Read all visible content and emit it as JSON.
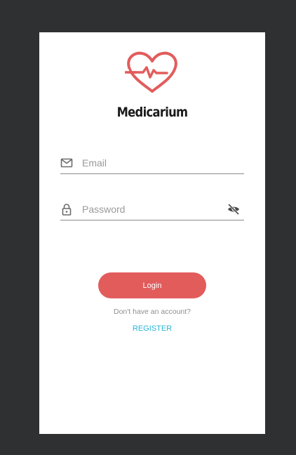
{
  "app": {
    "title": "Medicarium"
  },
  "login_form": {
    "email": {
      "placeholder": "Email",
      "value": "",
      "icon": "mail-icon"
    },
    "password": {
      "placeholder": "Password",
      "value": "",
      "icon": "lock-icon",
      "toggle_icon": "eye-off-icon"
    },
    "login_label": "Login",
    "no_account_text": "Don't have an account?",
    "register_label": "REGISTER"
  },
  "colors": {
    "background": "#2f3032",
    "card": "#ffffff",
    "brand_red": "#e25c5c",
    "link": "#29b6d6",
    "underline": "#8a8a8a"
  }
}
